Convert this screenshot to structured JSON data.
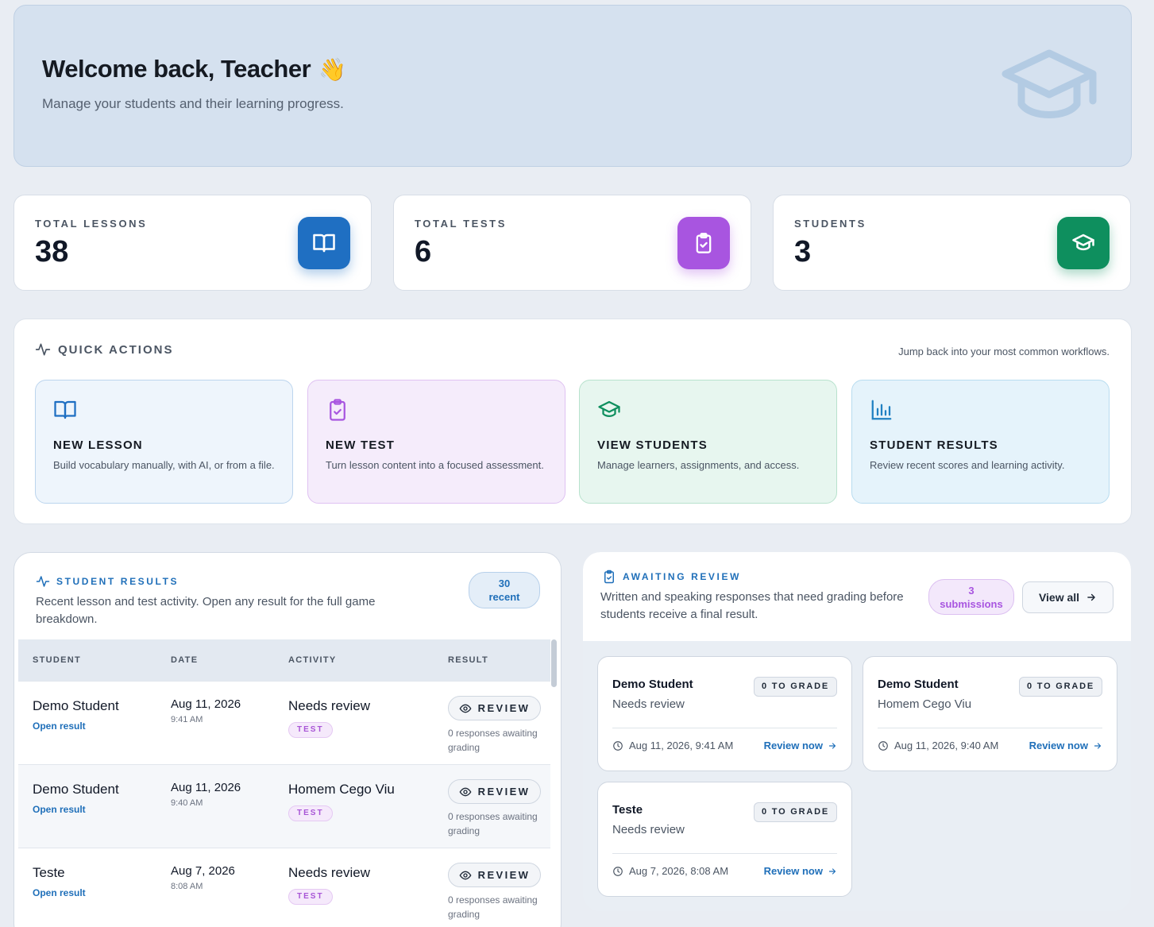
{
  "hero": {
    "title": "Welcome back, Teacher",
    "wave_emoji": "👋",
    "subtitle": "Manage your students and their learning progress.",
    "icon": "graduation-cap-icon"
  },
  "stats": [
    {
      "label": "TOTAL LESSONS",
      "value": "38",
      "icon": "book-open-icon",
      "color": "#1f6fc2"
    },
    {
      "label": "TOTAL TESTS",
      "value": "6",
      "icon": "clipboard-check-icon",
      "color": "#a855e0"
    },
    {
      "label": "STUDENTS",
      "value": "3",
      "icon": "graduation-cap-icon",
      "color": "#0e8f5e"
    }
  ],
  "quick_actions": {
    "title": "QUICK ACTIONS",
    "hint": "Jump back into your most common workflows.",
    "items": [
      {
        "title": "NEW LESSON",
        "desc": "Build vocabulary manually, with AI, or from a file.",
        "icon": "book-open-icon"
      },
      {
        "title": "NEW TEST",
        "desc": "Turn lesson content into a focused assessment.",
        "icon": "clipboard-check-icon"
      },
      {
        "title": "VIEW STUDENTS",
        "desc": "Manage learners, assignments, and access.",
        "icon": "graduation-cap-icon"
      },
      {
        "title": "STUDENT RESULTS",
        "desc": "Review recent scores and learning activity.",
        "icon": "bar-chart-icon"
      }
    ]
  },
  "student_results": {
    "title": "STUDENT RESULTS",
    "desc": "Recent lesson and test activity. Open any result for the full game breakdown.",
    "count_num": "30",
    "count_label": "recent",
    "columns": [
      "STUDENT",
      "DATE",
      "ACTIVITY",
      "RESULT"
    ],
    "rows": [
      {
        "student": "Demo Student",
        "open": "Open result",
        "date": "Aug 11, 2026",
        "time": "9:41 AM",
        "activity": "Needs review",
        "badge": "TEST",
        "review": "REVIEW",
        "resp": "0 responses awaiting grading"
      },
      {
        "student": "Demo Student",
        "open": "Open result",
        "date": "Aug 11, 2026",
        "time": "9:40 AM",
        "activity": "Homem Cego Viu",
        "badge": "TEST",
        "review": "REVIEW",
        "resp": "0 responses awaiting grading"
      },
      {
        "student": "Teste",
        "open": "Open result",
        "date": "Aug 7, 2026",
        "time": "8:08 AM",
        "activity": "Needs review",
        "badge": "TEST",
        "review": "REVIEW",
        "resp": "0 responses awaiting grading"
      }
    ]
  },
  "awaiting_review": {
    "title": "AWAITING REVIEW",
    "desc": "Written and speaking responses that need grading before students receive a final result.",
    "count_num": "3",
    "count_label": "submissions",
    "view_all": "View all",
    "cards": [
      {
        "name": "Demo Student",
        "activity": "Needs review",
        "grade": "0 TO GRADE",
        "date": "Aug 11, 2026, 9:41 AM",
        "link": "Review now"
      },
      {
        "name": "Demo Student",
        "activity": "Homem Cego Viu",
        "grade": "0 TO GRADE",
        "date": "Aug 11, 2026, 9:40 AM",
        "link": "Review now"
      },
      {
        "name": "Teste",
        "activity": "Needs review",
        "grade": "0 TO GRADE",
        "date": "Aug 7, 2026, 8:08 AM",
        "link": "Review now"
      }
    ]
  }
}
